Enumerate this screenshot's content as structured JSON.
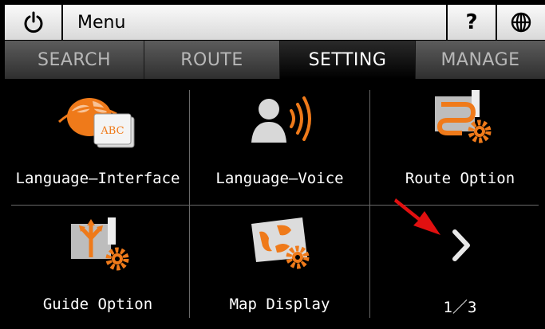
{
  "header": {
    "power_icon": "power-icon",
    "title": "Menu",
    "help_label": "?",
    "globe_icon": "globe-icon"
  },
  "tabs": [
    {
      "label": "SEARCH",
      "active": false
    },
    {
      "label": "ROUTE",
      "active": false
    },
    {
      "label": "SETTING",
      "active": true
    },
    {
      "label": "MANAGE",
      "active": false
    }
  ],
  "items": [
    {
      "label": "Language—Interface",
      "icon": "language-interface-icon"
    },
    {
      "label": "Language—Voice",
      "icon": "language-voice-icon"
    },
    {
      "label": "Route Option",
      "icon": "route-option-icon"
    },
    {
      "label": "Guide Option",
      "icon": "guide-option-icon"
    },
    {
      "label": "Map Display",
      "icon": "map-display-icon"
    }
  ],
  "paging": {
    "indicator": "1／3",
    "next_icon": "chevron-right-icon"
  },
  "colors": {
    "accent": "#ef7a1a",
    "annotation_arrow": "#e11010"
  }
}
